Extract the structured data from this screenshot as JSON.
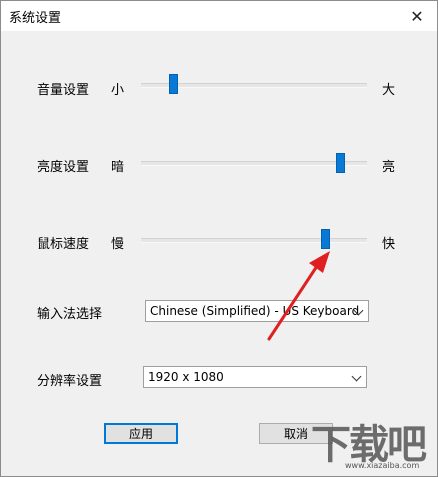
{
  "window": {
    "title": "系统设置",
    "close_glyph": "✕"
  },
  "settings": {
    "volume": {
      "label": "音量设置",
      "min_label": "小",
      "max_label": "大",
      "value_fraction": 0.13
    },
    "brightness": {
      "label": "亮度设置",
      "min_label": "暗",
      "max_label": "亮",
      "value_fraction": 0.9
    },
    "mouse_speed": {
      "label": "鼠标速度",
      "min_label": "慢",
      "max_label": "快",
      "value_fraction": 0.83
    },
    "input_method": {
      "label": "输入法选择",
      "selected": "Chinese (Simplified) - US Keyboard"
    },
    "resolution": {
      "label": "分辨率设置",
      "selected": "1920 x 1080"
    }
  },
  "buttons": {
    "apply_label": "应用",
    "cancel_label": "取消"
  },
  "watermark": {
    "text": "下载吧",
    "url": "www.xiazaiba.com"
  },
  "annotation": {
    "arrow_color": "#e02020"
  },
  "colors": {
    "thumb": "#0a79d6",
    "window_bg": "#f0f0f0"
  }
}
